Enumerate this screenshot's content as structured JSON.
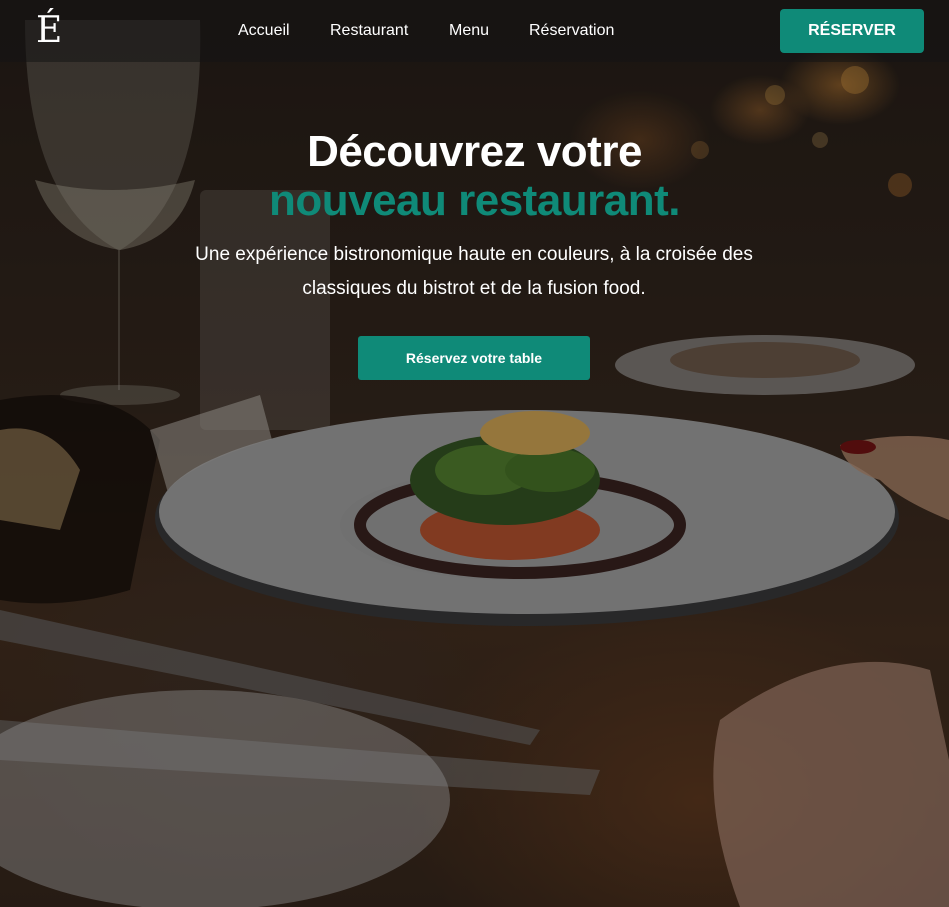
{
  "header": {
    "logo": "É",
    "nav": [
      {
        "label": "Accueil"
      },
      {
        "label": "Restaurant"
      },
      {
        "label": "Menu"
      },
      {
        "label": "Réservation"
      }
    ],
    "cta_label": "RÉSERVER"
  },
  "hero": {
    "title_line1": "Découvrez votre",
    "title_line2": "nouveau restaurant.",
    "subtitle": "Une expérience bistronomique haute en couleurs, à la croisée des classiques du bistrot et de la fusion food.",
    "cta_label": "Réservez votre table",
    "background": "restaurant-dinner-table-photo"
  },
  "colors": {
    "accent": "#0f8a78",
    "text": "#ffffff",
    "nav_background": "#141414"
  }
}
